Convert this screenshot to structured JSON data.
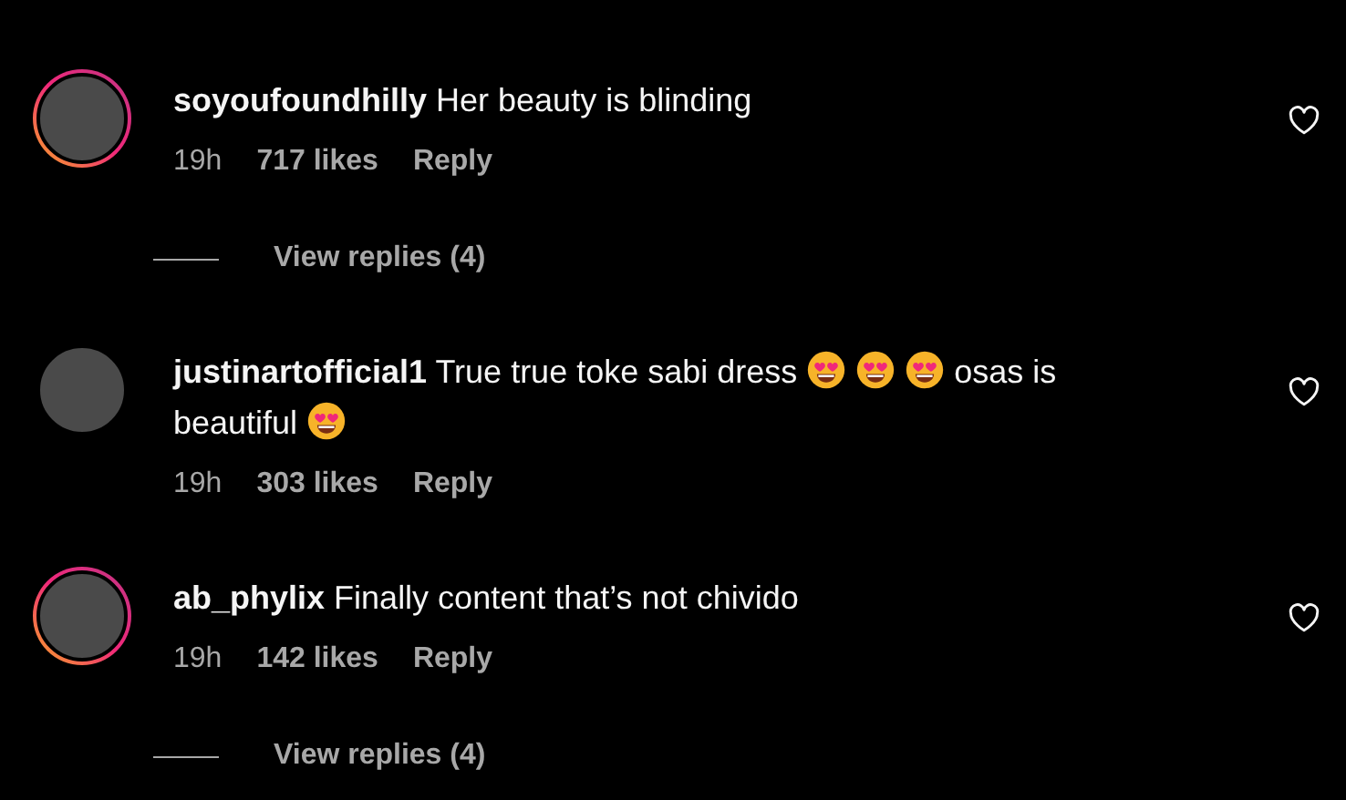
{
  "comments": [
    {
      "username": "soyoufoundhilly",
      "story_ring": true,
      "text": [
        {
          "kind": "text",
          "value": "Her beauty is blinding"
        }
      ],
      "time": "19h",
      "likes": "717 likes",
      "reply": "Reply",
      "liked": false,
      "view_replies": "View replies (4)"
    },
    {
      "username": "justinartofficial1",
      "story_ring": false,
      "text": [
        {
          "kind": "text",
          "value": "True true toke sabi dress "
        },
        {
          "kind": "emoji"
        },
        {
          "kind": "emoji"
        },
        {
          "kind": "emoji"
        },
        {
          "kind": "text",
          "value": "osas is beautiful "
        },
        {
          "kind": "emoji"
        }
      ],
      "time": "19h",
      "likes": "303 likes",
      "reply": "Reply",
      "liked": false
    },
    {
      "username": "ab_phylix",
      "story_ring": true,
      "text": [
        {
          "kind": "text",
          "value": "Finally content that’s not chivido"
        }
      ],
      "time": "19h",
      "likes": "142 likes",
      "reply": "Reply",
      "liked": false,
      "view_replies": "View replies (4)"
    }
  ]
}
